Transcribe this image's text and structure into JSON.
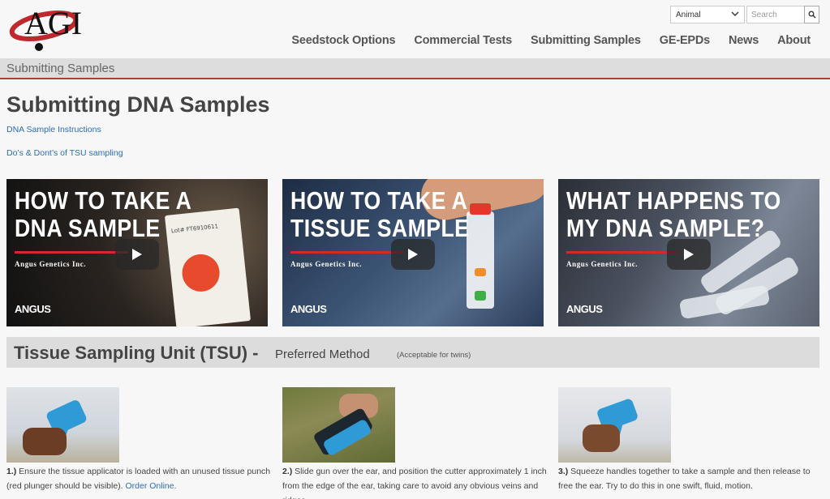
{
  "header": {
    "logo_text": "AGI",
    "animal_select": "Animal",
    "search_placeholder": "Search",
    "nav": [
      "Seedstock Options",
      "Commercial Tests",
      "Submitting Samples",
      "GE-EPDs",
      "News",
      "About"
    ]
  },
  "breadcrumb": "Submitting Samples",
  "page": {
    "title": "Submitting DNA Samples",
    "links": [
      "DNA Sample Instructions",
      "Do’s & Dont’s of TSU sampling"
    ]
  },
  "videos": [
    {
      "line1": "HOW TO TAKE A",
      "line2": "DNA SAMPLE",
      "sub": "Angus Genetics Inc.",
      "brand": "ANGUS"
    },
    {
      "line1": "HOW TO TAKE A",
      "line2": "TISSUE SAMPLE",
      "sub": "Angus Genetics Inc.",
      "brand": "ANGUS"
    },
    {
      "line1": "WHAT HAPPENS TO",
      "line2": "MY DNA SAMPLE?",
      "sub": "Angus Genetics Inc.",
      "brand": "ANGUS"
    }
  ],
  "video_card_lot": "Lot# FT6910611",
  "section": {
    "heading": "Tissue Sampling Unit (TSU) -",
    "subheading": "Preferred Method",
    "note": "(Acceptable for twins)"
  },
  "steps": [
    {
      "num": "1.)",
      "text": " Ensure the tissue applicator is loaded with an unused tissue punch (red plunger should be visible). ",
      "link": "Order Online."
    },
    {
      "num": "2.)",
      "text": " Slide gun over the ear, and position the cutter approximately 1 inch from the edge of the ear, taking care to avoid any obvious veins and ridges."
    },
    {
      "num": "3.)",
      "text": " Squeeze handles together to take a sample and then release to free the ear. Try to do this in one swift, fluid, motion."
    }
  ],
  "colors": {
    "accent_red": "#b5383c",
    "link_blue": "#2a6db3",
    "tool_blue": "#2e9bd6"
  }
}
